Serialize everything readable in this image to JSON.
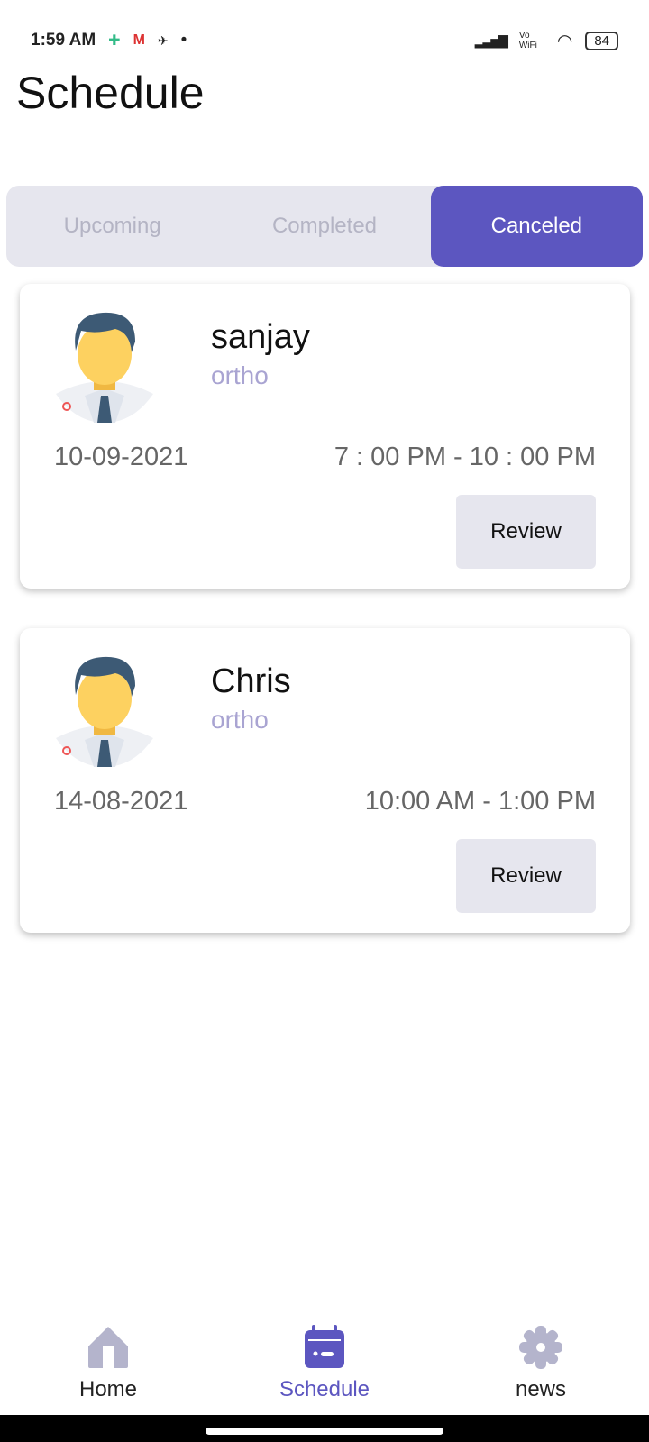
{
  "status_bar": {
    "time": "1:59 AM",
    "battery": "84",
    "network": "Vo WiFi",
    "icons": [
      "play-services-icon",
      "gmail-icon",
      "app-icon",
      "signal-icon",
      "wifi-icon",
      "battery-icon"
    ]
  },
  "header": {
    "title": "Schedule"
  },
  "tabs": [
    {
      "label": "Upcoming",
      "active": false
    },
    {
      "label": "Completed",
      "active": false
    },
    {
      "label": "Canceled",
      "active": true
    }
  ],
  "appointments": [
    {
      "name": "sanjay",
      "specialty": "ortho",
      "date": "10-09-2021",
      "time": "7 : 00 PM - 10 : 00 PM",
      "button": "Review"
    },
    {
      "name": "Chris",
      "specialty": "ortho",
      "date": "14-08-2021",
      "time": "10:00 AM - 1:00 PM",
      "button": "Review"
    }
  ],
  "bottom_nav": [
    {
      "label": "Home",
      "icon": "home-icon"
    },
    {
      "label": "Schedule",
      "icon": "calendar-icon",
      "active": true
    },
    {
      "label": "news",
      "icon": "gear-icon"
    }
  ],
  "colors": {
    "accent": "#5c56c0",
    "inactive_icon": "#b4b4cc",
    "tab_bg": "#e6e6ee",
    "specialty": "#a9a4d2"
  }
}
